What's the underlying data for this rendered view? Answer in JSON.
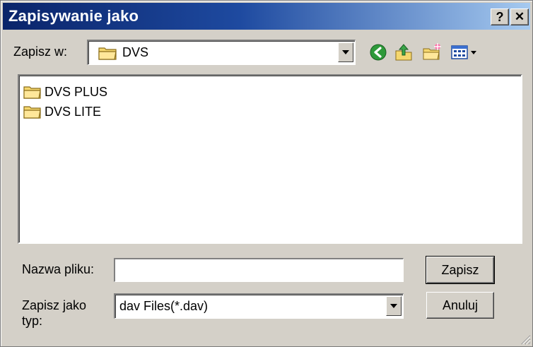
{
  "window": {
    "title": "Zapisywanie jako",
    "help_button": "?",
    "close_button": "✕"
  },
  "save_in": {
    "label": "Zapisz w:",
    "current_folder": "DVS"
  },
  "toolbar": {
    "icons": [
      "back-icon",
      "up-folder-icon",
      "new-folder-icon",
      "view-menu-icon"
    ]
  },
  "files": [
    {
      "name": "DVS PLUS",
      "type": "folder"
    },
    {
      "name": "DVS LITE",
      "type": "folder"
    }
  ],
  "filename": {
    "label": "Nazwa pliku:",
    "value": ""
  },
  "filetype": {
    "label_line1": "Zapisz jako",
    "label_line2": "typ:",
    "value": "dav Files(*.dav)"
  },
  "buttons": {
    "save": "Zapisz",
    "cancel": "Anuluj"
  },
  "colors": {
    "titlebar_start": "#0a246a",
    "titlebar_end": "#a6caf0",
    "dialog_face": "#d4d0c8",
    "folder_yellow": "#f5d76e"
  }
}
